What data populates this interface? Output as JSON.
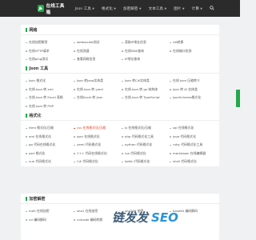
{
  "header": {
    "logo_text": "在线工具箱",
    "nav": [
      {
        "label": "Json 工具",
        "has_menu": true
      },
      {
        "label": "格式化",
        "has_menu": true
      },
      {
        "label": "加密解密",
        "has_menu": true
      },
      {
        "label": "文本工具",
        "has_menu": true
      },
      {
        "label": "图片",
        "has_menu": true
      },
      {
        "label": "计算",
        "has_menu": true
      }
    ],
    "search_icon": "search-icon"
  },
  "sections": [
    {
      "title": "网络",
      "items": [
        {
          "label": "在线加密解密",
          "hot": false
        },
        {
          "label": "websocket测试",
          "hot": false
        },
        {
          "label": "获取IP地址信息",
          "hot": false
        },
        {
          "label": "UA转换",
          "hot": false
        },
        {
          "label": "在线HTTP请求",
          "hot": false
        },
        {
          "label": "在线测速",
          "hot": false
        },
        {
          "label": "在线DNS查询",
          "hot": false
        },
        {
          "label": "在线端口检测",
          "hot": false
        },
        {
          "label": "在线ping测试",
          "hot": false
        },
        {
          "label": "查看网络信息",
          "hot": false
        },
        {
          "label": "IP地址查询",
          "hot": false
        },
        {
          "label": "",
          "hot": false
        }
      ]
    },
    {
      "title": "Json 工具",
      "items": [
        {
          "label": "Json 格式化",
          "hot": false
        },
        {
          "label": "Json 转Java实体类",
          "hot": false
        },
        {
          "label": "Json 转C#实体类",
          "hot": false
        },
        {
          "label": "在线 Json 压缩转义",
          "hot": false
        },
        {
          "label": "在线 Json 转 xml",
          "hot": false
        },
        {
          "label": "在线 Json 转 yaml",
          "hot": false
        },
        {
          "label": "在线 Json 转 go 结构体",
          "hot": false
        },
        {
          "label": "Json 转 JS 实体类",
          "hot": false
        },
        {
          "label": "在线 Json 转 Excel 表格",
          "hot": false
        },
        {
          "label": "在线Excel 转 Json",
          "hot": false
        },
        {
          "label": "在线 Json 转 TypeScript",
          "hot": false
        },
        {
          "label": "JsonSchema格式化",
          "hot": false
        },
        {
          "label": "在线 Json 转 PHP",
          "hot": false
        },
        {
          "label": "",
          "hot": false
        },
        {
          "label": "",
          "hot": false
        },
        {
          "label": "",
          "hot": false
        }
      ]
    },
    {
      "title": "格式化",
      "items": [
        {
          "label": "html 格式化/压缩",
          "hot": false
        },
        {
          "label": "css 在线格式化/压缩",
          "hot": true
        },
        {
          "label": "js 在线格式化/压缩",
          "hot": false
        },
        {
          "label": "sql 在线格式化",
          "hot": false
        },
        {
          "label": "xml 在线格式化",
          "hot": false
        },
        {
          "label": "json 在线格式化",
          "hot": false
        },
        {
          "label": "php 代码格式化工具",
          "hot": false
        },
        {
          "label": "java 代码格式化",
          "hot": false
        },
        {
          "label": "go 代码在线格式化",
          "hot": false
        },
        {
          "label": "yaml 代码格式化",
          "hot": false
        },
        {
          "label": "python 代码格式化",
          "hot": false
        },
        {
          "label": "ruby 代码格式化工具",
          "hot": false
        },
        {
          "label": "perl 格式化",
          "hot": false
        },
        {
          "label": "C++ 代码在线格式化",
          "hot": false
        },
        {
          "label": "lua 代码格式化",
          "hot": false
        },
        {
          "label": "markdown 在线编辑器",
          "hot": false
        },
        {
          "label": "vue 代码格式化",
          "hot": false
        },
        {
          "label": "C# 代码格式化",
          "hot": false
        },
        {
          "label": "kotlin 代码格式化",
          "hot": false
        },
        {
          "label": "shell 代码格式化",
          "hot": false
        }
      ]
    },
    {
      "title": "加密解密",
      "items": [
        {
          "label": "md5 在线加密",
          "hot": false
        },
        {
          "label": "sha1 在线加密",
          "hot": false
        },
        {
          "label": "sha256 加密",
          "hot": false
        },
        {
          "label": "base64 编码解码",
          "hot": false
        },
        {
          "label": "url 编码解码",
          "hot": false
        },
        {
          "label": "unicode 编码转换",
          "hot": false
        },
        {
          "label": "",
          "hot": false
        },
        {
          "label": "",
          "hot": false
        }
      ]
    }
  ],
  "watermark": {
    "text": "链发发",
    "seo": "SEO"
  },
  "colors": {
    "accent": "#22a94a",
    "header_bg": "#2b2b2b",
    "hot": "#e4432a",
    "page_bg": "#f0f1f3"
  }
}
